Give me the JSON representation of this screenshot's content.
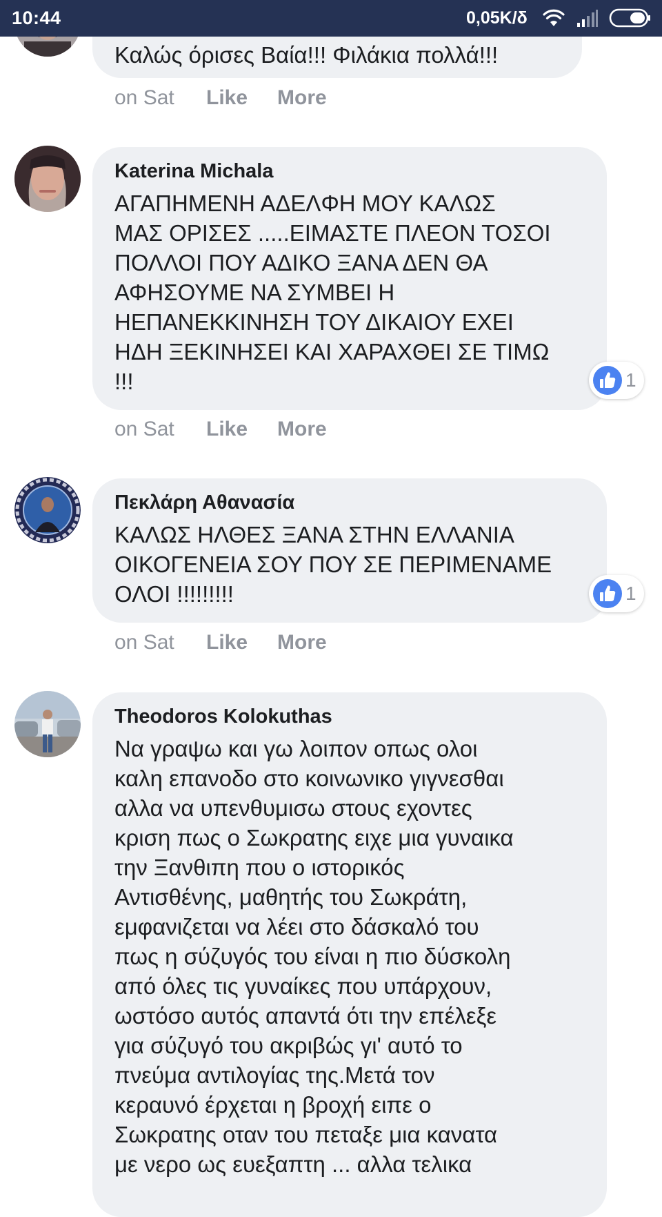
{
  "status_bar": {
    "time": "10:44",
    "network_speed": "0,05K/δ",
    "icons": [
      "wifi-icon",
      "signal-icon",
      "battery-icon"
    ]
  },
  "colors": {
    "status_bar_bg": "#253254",
    "bubble_bg": "#eef0f3",
    "meta_text": "#90949c",
    "like_blue": "#4b82f1"
  },
  "comments": [
    {
      "author": "",
      "text": "Καλώς όρισες Βαία!!! Φιλάκια πολλά!!!",
      "time": "on Sat",
      "like_label": "Like",
      "more_label": "More"
    },
    {
      "author": "Katerina Michala",
      "text": "ΑΓΑΠΗΜΕΝΗ ΑΔΕΛΦΗ ΜΟΥ ΚΑΛΩΣ\nΜΑΣ ΟΡΙΣΕΣ .....ΕΙΜΑΣΤΕ ΠΛΕΟΝ ΤΟΣΟΙ\nΠΟΛΛΟΙ ΠΟΥ ΑΔΙΚΟ ΞΑΝΑ ΔΕΝ ΘΑ\nΑΦΗΣΟΥΜΕ ΝΑ ΣΥΜΒΕΙ Η\nΗΕΠΑΝΕΚΚΙΝΗΣΗ ΤΟΥ ΔΙΚΑΙΟΥ ΕΧΕΙ\nΗΔΗ ΞΕΚΙΝΗΣΕΙ ΚΑΙ ΧΑΡΑΧΘΕΙ ΣΕ ΤΙΜΩ\n!!!",
      "reaction_count": "1",
      "time": "on Sat",
      "like_label": "Like",
      "more_label": "More"
    },
    {
      "author": "Πεκλάρη Αθανασία",
      "text": "ΚΑΛΩΣ ΗΛΘΕΣ ΞΑΝΑ ΣΤΗΝ ΕΛΛΑΝΙΑ\nΟΙΚΟΓΕΝΕΙΑ ΣΟΥ ΠΟΥ ΣΕ ΠΕΡΙΜΕΝΑΜΕ\nΟΛΟΙ !!!!!!!!!",
      "reaction_count": "1",
      "time": "on Sat",
      "like_label": "Like",
      "more_label": "More"
    },
    {
      "author": "Theodoros Kolokuthas",
      "text": "Να γραψω και γω λοιπον οπως ολοι\nκαλη επανοδο στο κοινωνικο γιγνεσθαι\nαλλα να υπενθυμισω στους εχοντες\nκριση πως ο Σωκρατης ειχε μια γυναικα\nτην Ξανθιπη που ο ιστορικός\nΑντισθένης, μαθητής του Σωκράτη,\nεμφανιζεται να λέει στο δάσκαλό του\nπως η σύζυγός του είναι η πιο δύσκολη\nαπό όλες τις γυναίκες που υπάρχουν,\nωστόσο αυτός απαντά ότι την επέλεξε\nγια σύζυγό του ακριβώς γι' αυτό το\nπνεύμα αντιλογίας της.Μετά τον\nκεραυνό έρχεται η βροχή ειπε ο\nΣωκρατης οταν του πεταξε μια κανατα\nμε νερο ως ευεξαπτη ... αλλα τελικα"
    }
  ]
}
